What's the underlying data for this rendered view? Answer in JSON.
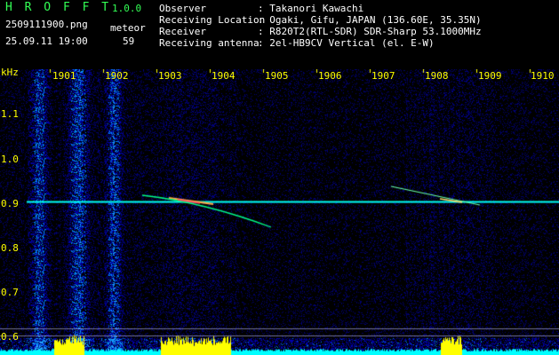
{
  "header": {
    "app_name": "H R O F F T",
    "version": "1.0.0",
    "filename": "2509111900.png",
    "datetime": "25.09.11 19:00",
    "meteor_label": "meteor",
    "meteor_count": "59",
    "info": [
      {
        "label": "Observer",
        "value": ": Takanori Kawachi"
      },
      {
        "label": "Receiving Location",
        "value": ": Ogaki, Gifu, JAPAN (136.60E, 35.35N)"
      },
      {
        "label": "Receiver",
        "value": ": R820T2(RTL-SDR) SDR-Sharp 53.1000MHz"
      },
      {
        "label": "Receiving antenna",
        "value": ": 2el-HB9CV Vertical (el. E-W)"
      }
    ]
  },
  "spectrogram": {
    "unit_label": "kHz",
    "x_ticks": [
      "1901",
      "1902",
      "1903",
      "1904",
      "1905",
      "1906",
      "1907",
      "1908",
      "1909",
      "1910"
    ],
    "y_ticks": [
      "1.1",
      "1.0",
      "0.9",
      "0.8",
      "0.7",
      "0.6"
    ],
    "colors": {
      "label": "#ffff00",
      "carrier": "#00ffff",
      "noise": "#0000aa",
      "header_green": "#33ff55"
    }
  }
}
